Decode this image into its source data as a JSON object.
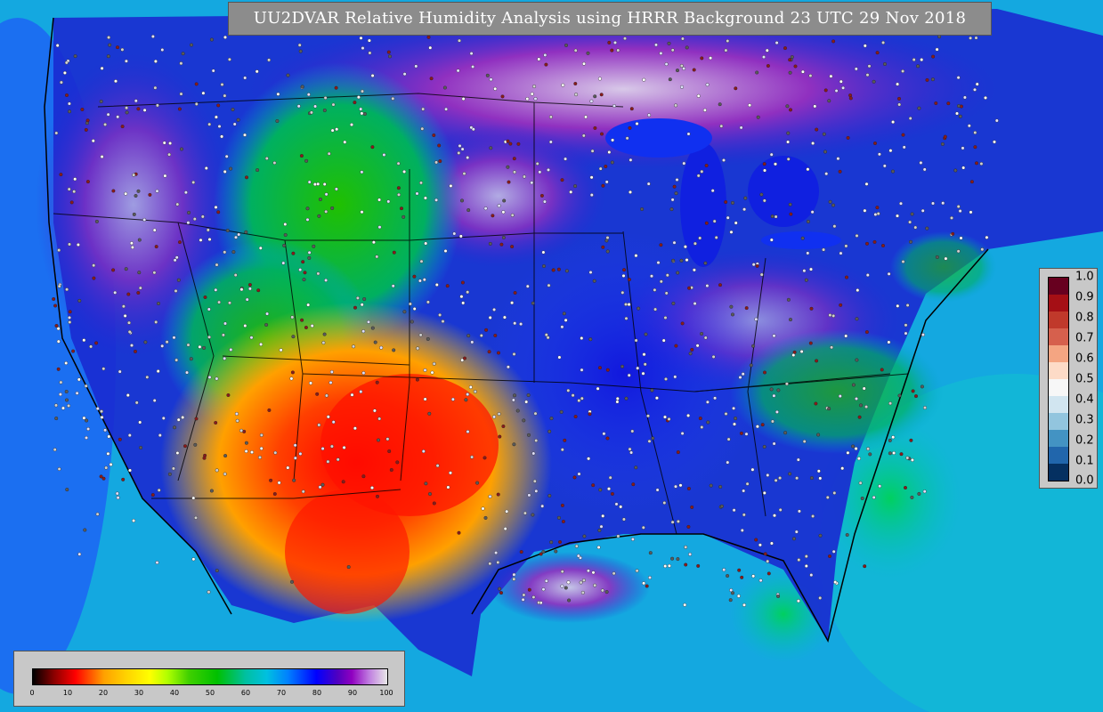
{
  "title": "UU2DVAR Relative Humidity Analysis using HRRR Background 23 UTC 29 Nov 2018",
  "colorbar_horizontal": {
    "ticks": [
      "0",
      "10",
      "20",
      "30",
      "40",
      "50",
      "60",
      "70",
      "80",
      "90",
      "100"
    ]
  },
  "colorbar_vertical": {
    "ticks": [
      "1.0",
      "0.9",
      "0.8",
      "0.7",
      "0.6",
      "0.5",
      "0.4",
      "0.3",
      "0.2",
      "0.1",
      "0.0"
    ],
    "colors": [
      "#67001f",
      "#a50f15",
      "#c0392b",
      "#d6604d",
      "#f4a582",
      "#fddbc7",
      "#f7f7f7",
      "#d1e5f0",
      "#92c5de",
      "#4393c3",
      "#2166ac",
      "#053061"
    ]
  }
}
